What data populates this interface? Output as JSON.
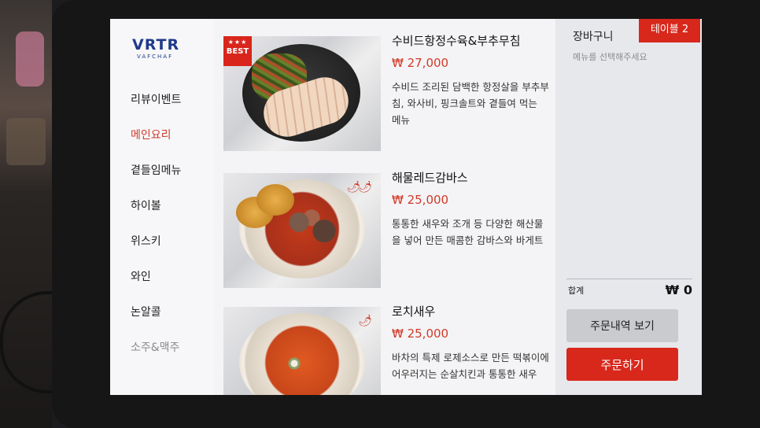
{
  "brand": {
    "logo_main": "VRTR",
    "logo_sub": "VAFCHAF"
  },
  "sidebar": {
    "items": [
      {
        "label": "리뷰이벤트",
        "state": "normal"
      },
      {
        "label": "메인요리",
        "state": "active"
      },
      {
        "label": "곁들임메뉴",
        "state": "normal"
      },
      {
        "label": "하이볼",
        "state": "normal"
      },
      {
        "label": "위스키",
        "state": "normal"
      },
      {
        "label": "와인",
        "state": "normal"
      },
      {
        "label": "논알콜",
        "state": "normal"
      },
      {
        "label": "소주&맥주",
        "state": "faded"
      }
    ]
  },
  "menu": {
    "items": [
      {
        "name": "수비드항정수육&부추무침",
        "price": "₩ 27,000",
        "description": "수비드 조리된 담백한 항정살을 부추부침, 와사비, 핑크솔트와 곁들여 먹는 메뉴",
        "badge": {
          "stars": "★★★",
          "text": "BEST"
        },
        "icon": "dish-photo-icon"
      },
      {
        "name": "해물레드감바스",
        "price": "₩ 25,000",
        "description": "통통한 새우와 조개 등 다양한 해산물을 넣어 만든 매콤한 감바스와 바게트",
        "spicy": "🌶🌶",
        "icon": "chili-icon"
      },
      {
        "name": "로치새우",
        "price": "₩ 25,000",
        "description": "바차의 특제 로제소스로 만든 떡볶이에 어우러지는 순살치킨과 통통한 새우",
        "spicy": "🌶",
        "icon": "chili-icon"
      }
    ]
  },
  "cart": {
    "title": "장바구니",
    "table_label": "테이블 2",
    "empty_message": "메뉴를 선택해주세요",
    "total_label": "합계",
    "total_value": "₩ 0",
    "history_button": "주문내역 보기",
    "order_button": "주문하기"
  },
  "colors": {
    "accent": "#d8281c",
    "active_nav": "#d03a2a",
    "logo": "#1f3a8a"
  }
}
